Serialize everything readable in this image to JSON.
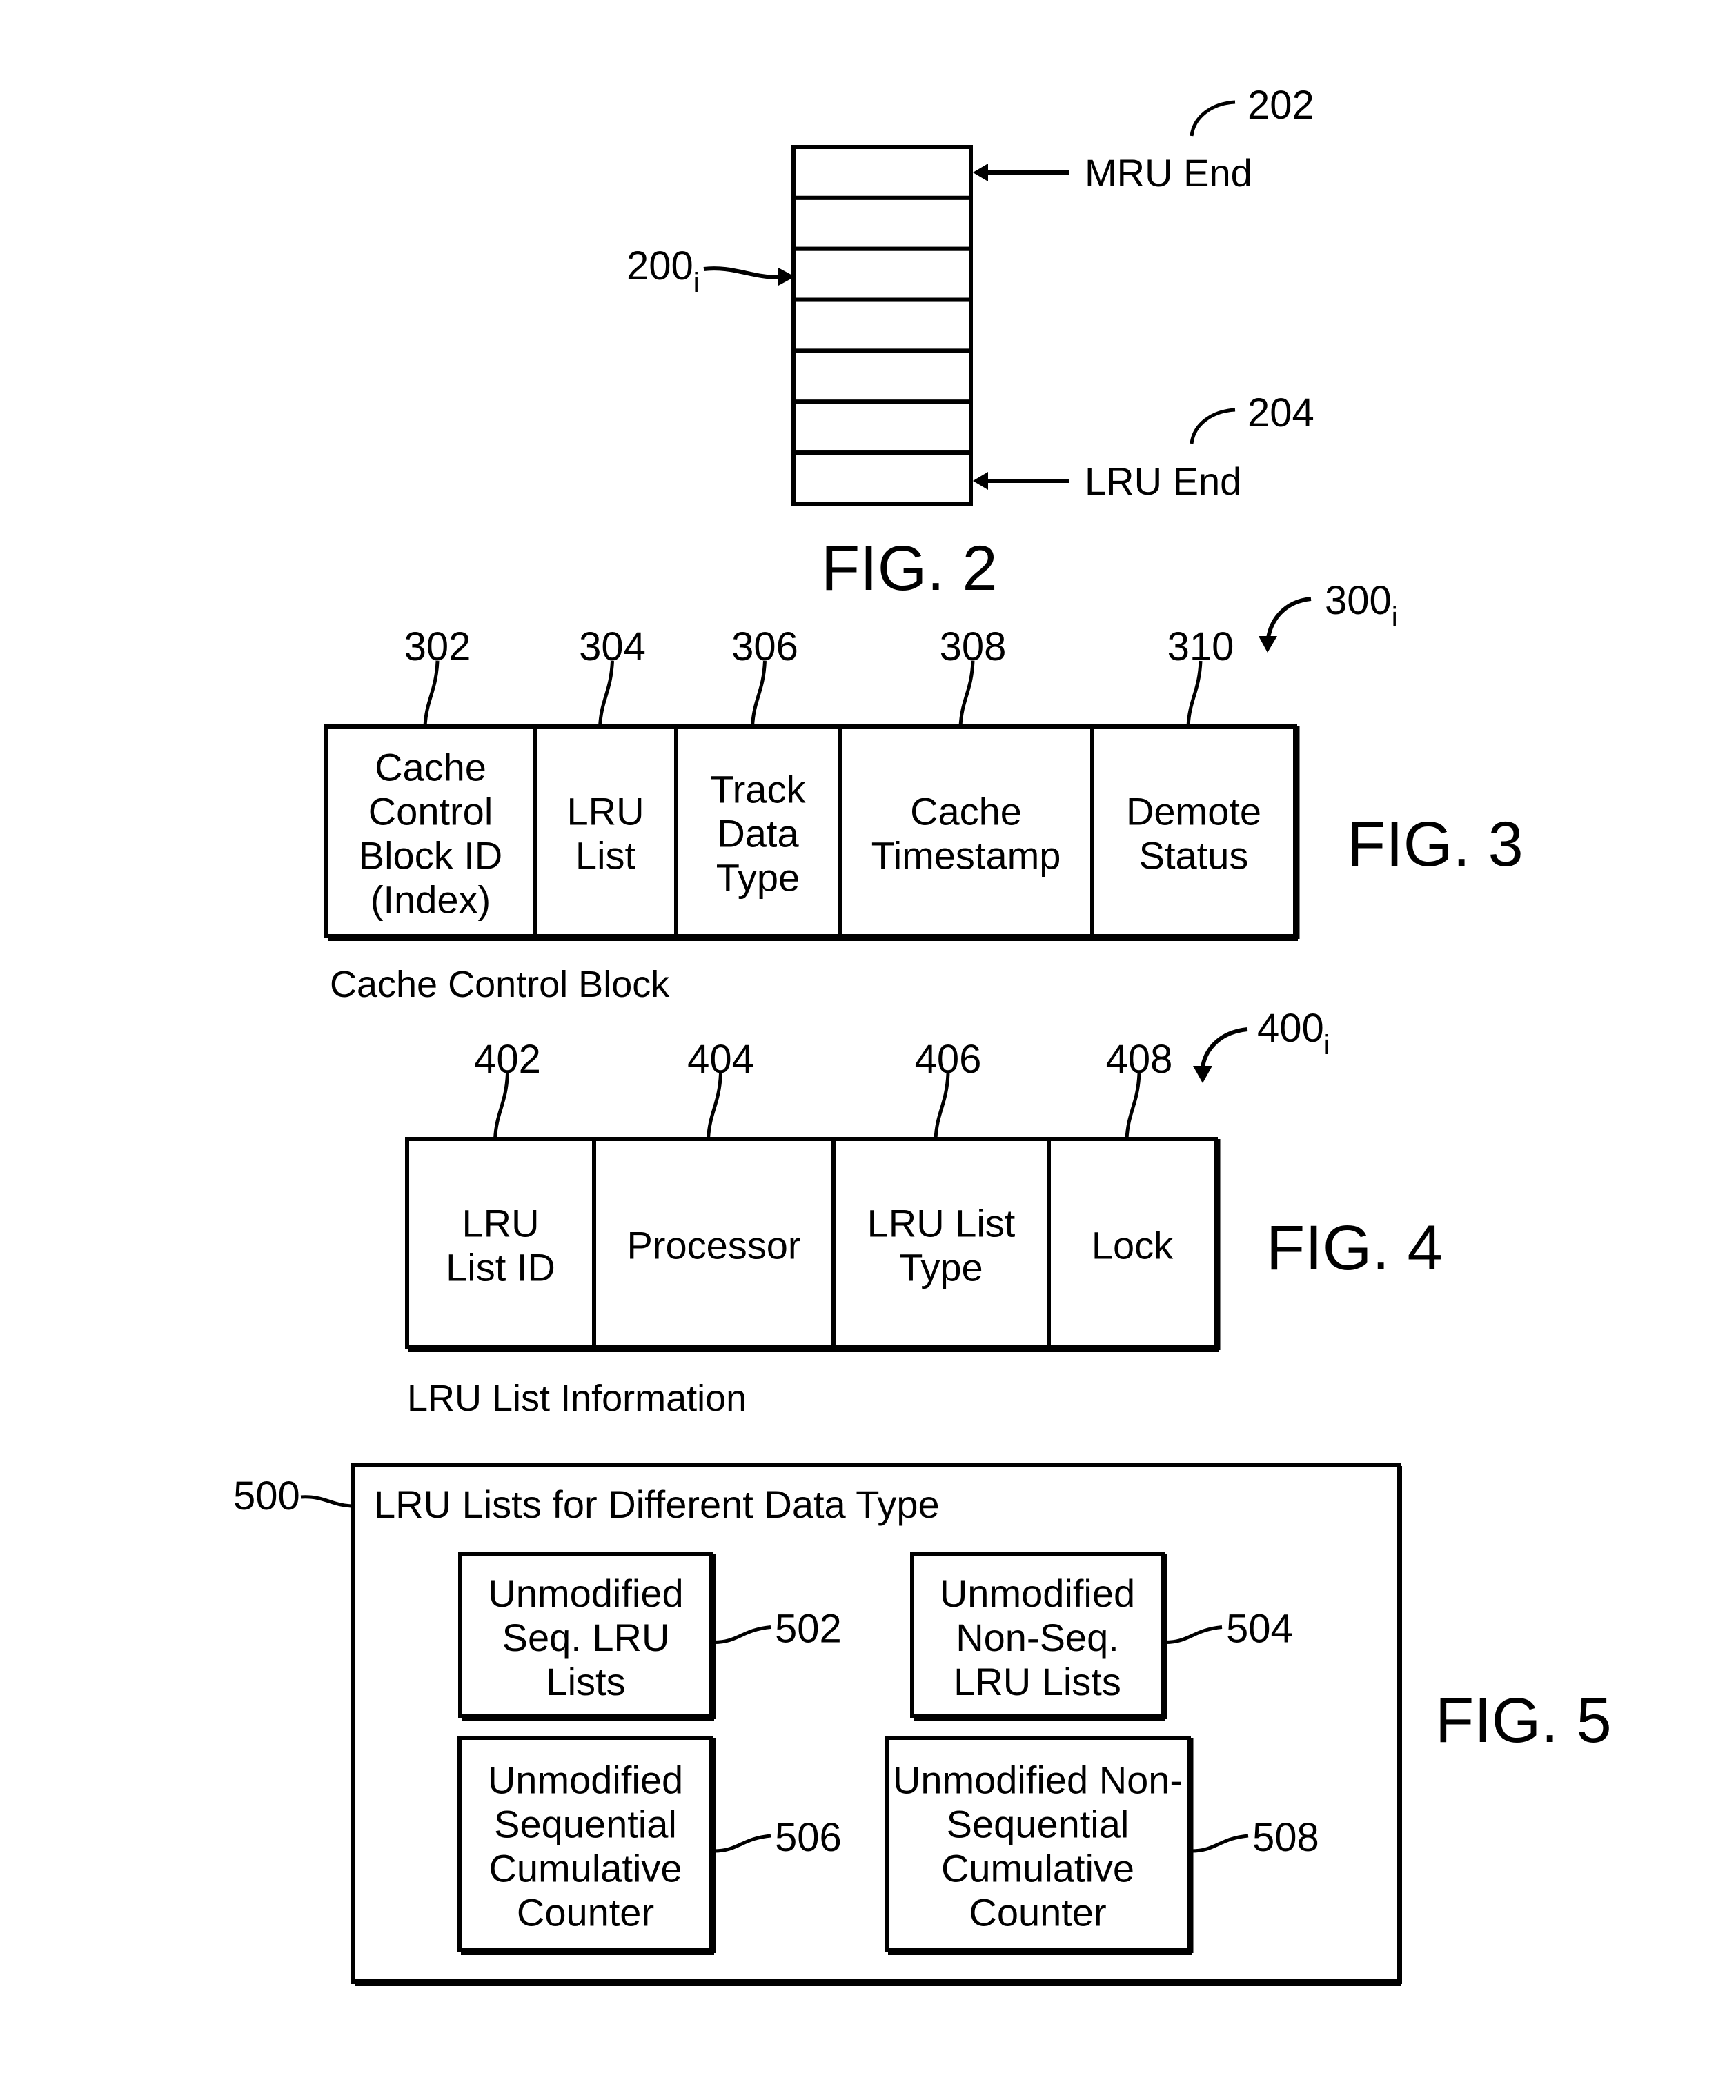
{
  "figures": {
    "fig2": {
      "caption": "FIG. 2",
      "ref_list": "200",
      "ref_list_sub": "i",
      "mru": {
        "label": "MRU End",
        "ref": "202"
      },
      "lru": {
        "label": "LRU End",
        "ref": "204"
      },
      "cell_count": 7
    },
    "fig3": {
      "caption": "FIG. 3",
      "title": "Cache Control Block",
      "ref": "300",
      "ref_sub": "i",
      "fields": [
        {
          "ref": "302",
          "lines": [
            "Cache",
            "Control",
            "Block ID",
            "(Index)"
          ]
        },
        {
          "ref": "304",
          "lines": [
            "LRU",
            "List"
          ]
        },
        {
          "ref": "306",
          "lines": [
            "Track",
            "Data",
            "Type"
          ]
        },
        {
          "ref": "308",
          "lines": [
            "Cache",
            "Timestamp"
          ]
        },
        {
          "ref": "310",
          "lines": [
            "Demote",
            "Status"
          ]
        }
      ]
    },
    "fig4": {
      "caption": "FIG. 4",
      "title": "LRU List Information",
      "ref": "400",
      "ref_sub": "i",
      "fields": [
        {
          "ref": "402",
          "lines": [
            "LRU",
            "List ID"
          ]
        },
        {
          "ref": "404",
          "lines": [
            "Processor"
          ]
        },
        {
          "ref": "406",
          "lines": [
            "LRU List",
            "Type"
          ]
        },
        {
          "ref": "408",
          "lines": [
            "Lock"
          ]
        }
      ]
    },
    "fig5": {
      "caption": "FIG. 5",
      "ref": "500",
      "title": "LRU Lists for Different Data Type",
      "boxes": [
        {
          "ref": "502",
          "lines": [
            "Unmodified",
            "Seq. LRU",
            "Lists"
          ]
        },
        {
          "ref": "504",
          "lines": [
            "Unmodified",
            "Non-Seq.",
            "LRU Lists"
          ]
        },
        {
          "ref": "506",
          "lines": [
            "Unmodified",
            "Sequential",
            "Cumulative",
            "Counter"
          ]
        },
        {
          "ref": "508",
          "lines": [
            "Unmodified Non-",
            "Sequential",
            "Cumulative",
            "Counter"
          ]
        }
      ]
    }
  }
}
